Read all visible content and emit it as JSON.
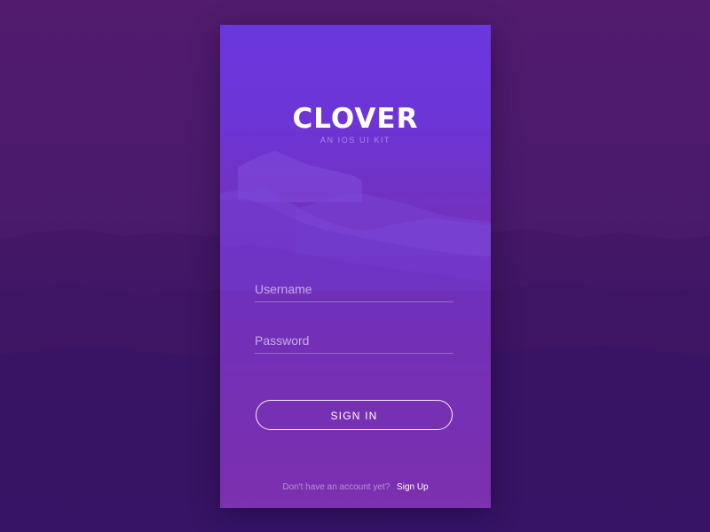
{
  "app": {
    "title": "CLOVER",
    "subtitle": "AN IOS UI KIT"
  },
  "login": {
    "username_placeholder": "Username",
    "username_value": "",
    "password_placeholder": "Password",
    "password_value": "",
    "signin_label": "SIGN IN"
  },
  "footer": {
    "prompt": "Don't have an account yet?",
    "signup_label": "Sign Up"
  },
  "colors": {
    "background": "#4a1a6c",
    "card_top": "#6a36de",
    "card_bottom": "#a03184",
    "text": "#ffffff"
  }
}
